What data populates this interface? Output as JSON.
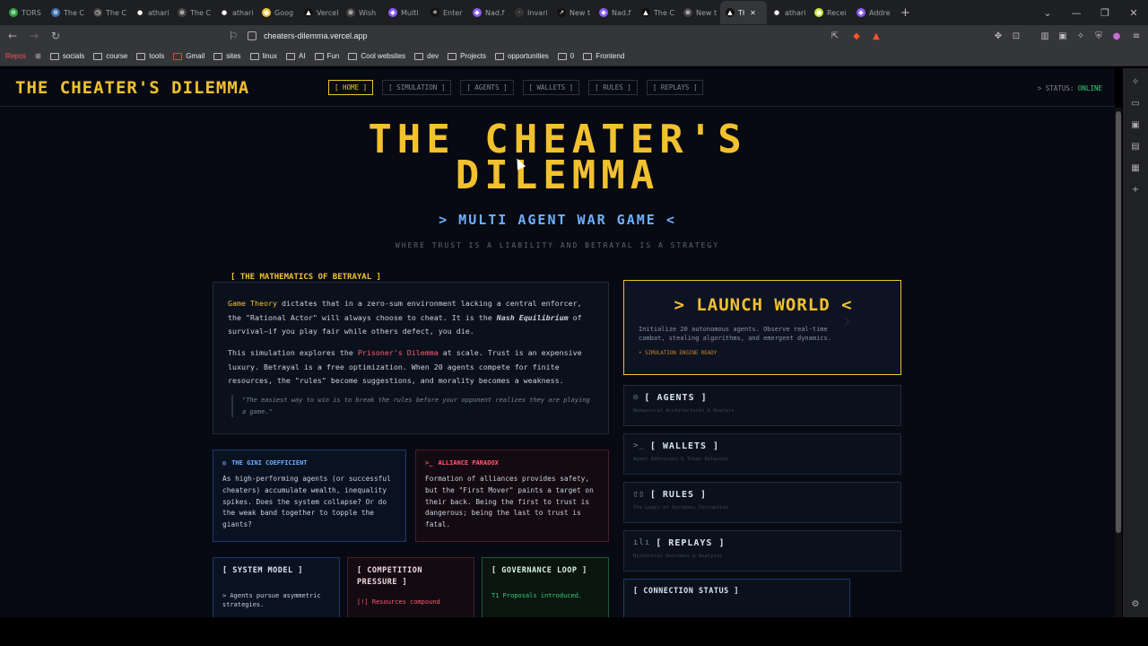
{
  "browser": {
    "tabs": [
      {
        "label": "TORS",
        "color": "#2ea043",
        "glyph": "⊕"
      },
      {
        "label": "The C",
        "color": "#3b6ea8",
        "glyph": "⊕"
      },
      {
        "label": "The C",
        "color": "#444",
        "glyph": "◷"
      },
      {
        "label": "athari",
        "color": "#222",
        "glyph": "●"
      },
      {
        "label": "The C",
        "color": "#444",
        "glyph": "⊛"
      },
      {
        "label": "athari",
        "color": "#222",
        "glyph": "●"
      },
      {
        "label": "Goog",
        "color": "#f2c12e",
        "glyph": "●"
      },
      {
        "label": "Vercel",
        "color": "#111",
        "glyph": "▲"
      },
      {
        "label": "Wish",
        "color": "#444",
        "glyph": "⊛"
      },
      {
        "label": "Multi",
        "color": "#8a5cf6",
        "glyph": "◆"
      },
      {
        "label": "Enter",
        "color": "#111",
        "glyph": "✳"
      },
      {
        "label": "Nad.f",
        "color": "#8a5cf6",
        "glyph": "◆"
      },
      {
        "label": "Invari",
        "color": "#333",
        "glyph": "·"
      },
      {
        "label": "New t",
        "color": "#111",
        "glyph": "↗"
      },
      {
        "label": "Nad.f",
        "color": "#8a5cf6",
        "glyph": "◆"
      },
      {
        "label": "The C",
        "color": "#111",
        "glyph": "▲"
      },
      {
        "label": "New t",
        "color": "#444",
        "glyph": "⊛"
      },
      {
        "label": "Tł",
        "color": "#111",
        "glyph": "▲",
        "active": true
      },
      {
        "label": "athari",
        "color": "#222",
        "glyph": "●"
      },
      {
        "label": "Recei",
        "color": "#c5e633",
        "glyph": "●"
      },
      {
        "label": "Addre",
        "color": "#8a5cf6",
        "glyph": "◆"
      }
    ],
    "url": "cheaters-dilemma.vercel.app",
    "bookmarks": [
      "Repos",
      "socials",
      "course",
      "tools",
      "Gmail",
      "sites",
      "linux",
      "AI",
      "Fun",
      "Cool websites",
      "dev",
      "Projects",
      "opportunities",
      "0",
      "Frontend"
    ]
  },
  "site": {
    "logo": "THE CHEATER'S DILEMMA",
    "nav": [
      "[ HOME ]",
      "[ SIMULATION ]",
      "[ AGENTS ]",
      "[ WALLETS ]",
      "[ RULES ]",
      "[ REPLAYS ]"
    ],
    "status_label": "> STATUS:",
    "status_value": "ONLINE",
    "hero_line1": "THE CHEATER'S",
    "hero_line2": "DILEMMA",
    "subtitle": "> MULTI AGENT WAR GAME <",
    "tagline": "WHERE TRUST IS A LIABILITY AND BETRAYAL IS A STRATEGY",
    "math": {
      "label": "[ THE MATHEMATICS OF BETRAYAL ]",
      "p1_a": "Game Theory",
      "p1_b": " dictates that in a zero-sum environment lacking a central enforcer, the \"Rational Actor\" will always choose to cheat. It is the ",
      "p1_c": "Nash Equilibrium",
      "p1_d": " of survival—if you play fair while others defect, you die.",
      "p2_a": "This simulation explores the ",
      "p2_b": "Prisoner's Dilemma",
      "p2_c": " at scale. Trust is an expensive luxury. Betrayal is a free optimization. When 20 agents compete for finite resources, the \"rules\" become suggestions, and morality becomes a weakness.",
      "quote": "\"The easiest way to win is to break the rules before your opponent realizes they are playing a game.\""
    },
    "gini": {
      "title": "THE GINI COEFFICIENT",
      "body": "As high-performing agents (or successful cheaters) accumulate wealth, inequality spikes. Does the system collapse? Or do the weak band together to topple the giants?"
    },
    "alliance": {
      "title": "ALLIANCE PARADOX",
      "prefix": ">_",
      "body": "Formation of alliances provides safety, but the \"First Mover\" paints a target on their back. Being the first to trust is dangerous; being the last to trust is fatal."
    },
    "mini": {
      "system_title": "[ SYSTEM MODEL ]",
      "system_text": "> Agents pursue asymmetric strategies.",
      "comp_title": "[ COMPETITION PRESSURE ]",
      "comp_text": "[!] Resources compound",
      "gov_title": "[ GOVERNANCE LOOP ]",
      "gov_text": "T1 Proposals introduced."
    },
    "launch": {
      "title": "> LAUNCH WORLD <",
      "desc": "Initialize 20 autonomous agents. Observe real-time combat, stealing algorithms, and emergent dynamics.",
      "ready": "• SIMULATION ENGINE READY"
    },
    "side_cards": [
      {
        "icon": "◎",
        "title": "[ AGENTS ]",
        "sub": "Behavioral Architectures & Avatars"
      },
      {
        "icon": ">_",
        "title": "[ WALLETS ]",
        "sub": "Agent Addresses & Token Balances"
      },
      {
        "icon": "▯▯",
        "title": "[ RULES ]",
        "sub": "The Logic of Systemic Corruption"
      },
      {
        "icon": "ılı",
        "title": "[ REPLAYS ]",
        "sub": "Historical Outcomes & Analysis"
      }
    ],
    "connection_title": "[ CONNECTION STATUS ]"
  },
  "colors": {
    "accent_yellow": "#f2c12e",
    "accent_blue": "#6fb0ff",
    "accent_red": "#ff5a72",
    "accent_green": "#2fd27a",
    "background": "#070a12"
  }
}
